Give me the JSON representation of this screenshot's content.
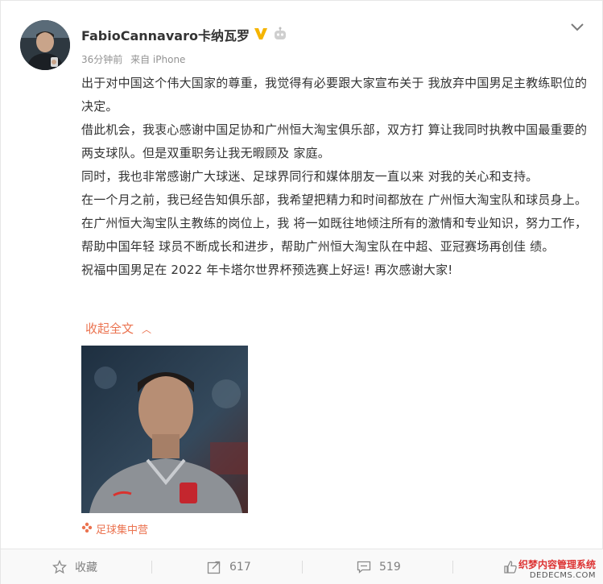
{
  "post": {
    "author": "FabioCannavaro卡纳瓦罗",
    "time": "36分钟前",
    "source": "来自 iPhone",
    "paragraphs": [
      "出于对中国这个伟大国家的尊重，我觉得有必要跟大家宣布关于 我放弃中国男足主教练职位的决定。",
      "借此机会，我衷心感谢中国足协和广州恒大淘宝俱乐部，双方打 算让我同时执教中国最重要的两支球队。但是双重职务让我无暇顾及 家庭。",
      "同时，我也非常感谢广大球迷、足球界同行和媒体朋友一直以来 对我的关心和支持。",
      "在一个月之前，我已经告知俱乐部，我希望把精力和时间都放在 广州恒大淘宝队和球员身上。在广州恒大淘宝队主教练的岗位上，我 将一如既往地倾注所有的激情和专业知识，努力工作，帮助中国年轻 球员不断成长和进步，帮助广州恒大淘宝队在中超、亚冠赛场再创佳 绩。",
      "祝福中国男足在 2022 年卡塔尔世界杯预选赛上好运! 再次感谢大家!"
    ],
    "collapse_label": "收起全文",
    "image_source": "足球集中营"
  },
  "actions": {
    "favorite": "收藏",
    "forward_count": "617",
    "comment_count": "519"
  },
  "watermark": {
    "line1": "织梦内容管理系统",
    "line2": "DEDECMS.COM"
  },
  "colors": {
    "accent": "#eb7350",
    "verified": "#f5b400",
    "text": "#333333",
    "meta": "#939393"
  },
  "icons": [
    "verified-v-icon",
    "robot-icon",
    "chevron-down-icon",
    "flower-icon",
    "star-icon",
    "forward-icon",
    "comment-icon",
    "like-icon"
  ]
}
